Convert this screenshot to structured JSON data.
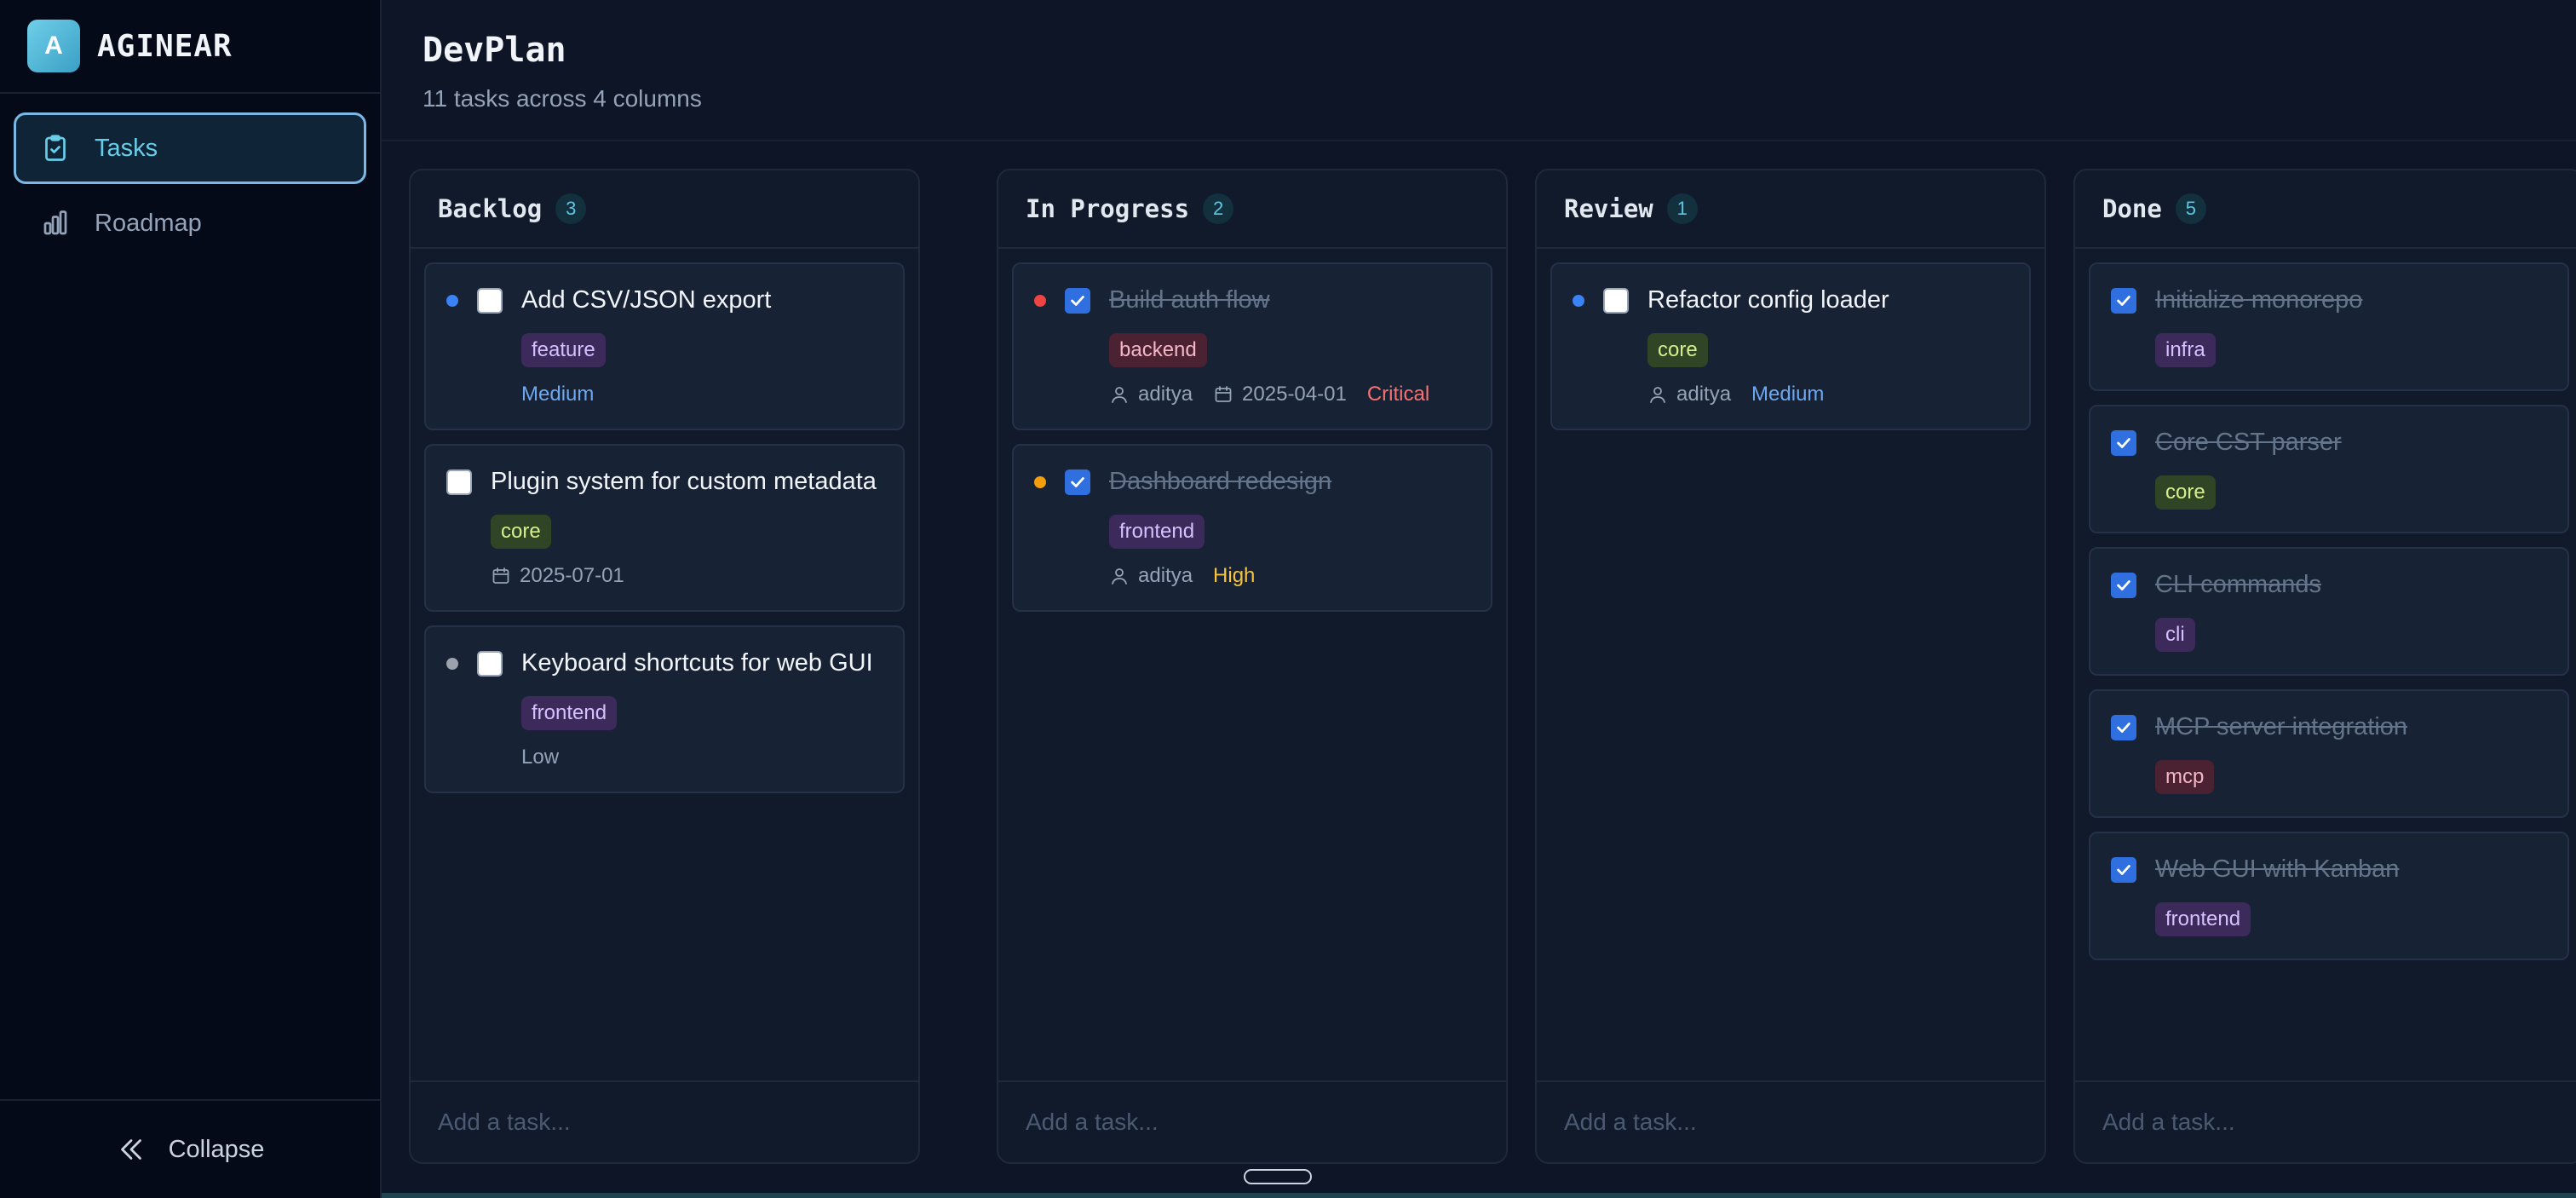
{
  "brand": {
    "logo_letter": "A",
    "name": "AGINEAR"
  },
  "sidebar": {
    "items": [
      {
        "label": "Tasks",
        "icon": "clipboard-check-icon",
        "active": true
      },
      {
        "label": "Roadmap",
        "icon": "bar-chart-icon",
        "active": false
      }
    ],
    "collapse_label": "Collapse"
  },
  "header": {
    "title": "DevPlan",
    "subtitle": "11 tasks across 4 columns"
  },
  "add_task_placeholder": "Add a task...",
  "columns": [
    {
      "title": "Backlog",
      "count": "3",
      "cards": [
        {
          "title": "Add CSV/JSON export",
          "dot": "#3b82f6",
          "checked": false,
          "tag": "feature",
          "priority": "Medium"
        },
        {
          "title": "Plugin system for custom metadata",
          "checked": false,
          "tag": "core",
          "date": "2025-07-01"
        },
        {
          "title": "Keyboard shortcuts for web GUI",
          "dot": "#9ca3af",
          "checked": false,
          "tag": "frontend",
          "priority": "Low"
        }
      ]
    },
    {
      "title": "In Progress",
      "count": "2",
      "cards": [
        {
          "title": "Build auth flow",
          "dot": "#ef4444",
          "checked": true,
          "tag": "backend",
          "assignee": "aditya",
          "date": "2025-04-01",
          "priority": "Critical"
        },
        {
          "title": "Dashboard redesign",
          "dot": "#f59e0b",
          "checked": true,
          "tag": "frontend",
          "assignee": "aditya",
          "priority": "High"
        }
      ]
    },
    {
      "title": "Review",
      "count": "1",
      "cards": [
        {
          "title": "Refactor config loader",
          "dot": "#3b82f6",
          "checked": false,
          "tag": "core",
          "assignee": "aditya",
          "priority": "Medium"
        }
      ]
    },
    {
      "title": "Done",
      "count": "5",
      "cards": [
        {
          "title": "Initialize monorepo",
          "checked": true,
          "tag": "infra"
        },
        {
          "title": "Core CST parser",
          "checked": true,
          "tag": "core"
        },
        {
          "title": "CLI commands",
          "checked": true,
          "tag": "cli"
        },
        {
          "title": "MCP server integration",
          "checked": true,
          "tag": "mcp"
        },
        {
          "title": "Web GUI with Kanban",
          "checked": true,
          "tag": "frontend"
        }
      ]
    }
  ],
  "colors": {
    "accent": "#67cde8",
    "checkbox_checked": "#2f6fe0",
    "priority_medium": "#6ea8f0",
    "priority_high": "#f5c542",
    "priority_critical": "#f87171"
  }
}
